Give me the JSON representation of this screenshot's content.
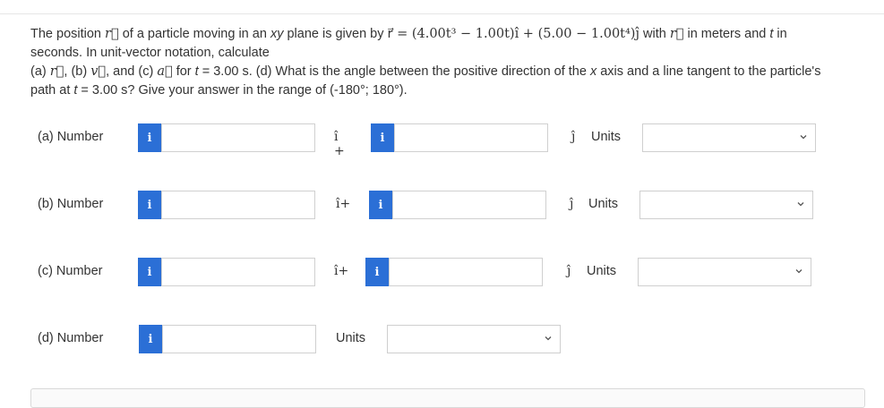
{
  "question": {
    "line1_a": "The position ",
    "r_sym": "r⃗",
    "line1_b": " of a particle moving in an ",
    "xy": "xy",
    "line1_c": " plane is given by ",
    "equation": "r⃗ = (4.00t³ − 1.00t)î + (5.00 − 1.00t⁴)ĵ",
    "line1_d": " with ",
    "line1_e": " in meters and ",
    "t": "t",
    "line1_f": " in",
    "line2": "seconds. In unit-vector notation, calculate",
    "line3_a": "(a) ",
    "line3_b": ", (b) ",
    "v_sym": "v⃗",
    "line3_c": ", and (c) ",
    "a_sym": "a⃗",
    "line3_d": " for ",
    "line3_e": " = 3.00 s. (d) What is the angle between the positive direction of the ",
    "x": "x",
    "line3_f": " axis and a line tangent to the particle's",
    "line4_a": "path at ",
    "line4_b": " = 3.00 s? Give your answer in the range of (-180°; 180°)."
  },
  "rows": [
    {
      "label": "(a)  Number",
      "i_btn": "i",
      "mid_unit": "î +",
      "j_unit": "ĵ",
      "units_label": "Units",
      "value1": "",
      "value2": "",
      "units_value": ""
    },
    {
      "label": "(b)  Number",
      "i_btn": "i",
      "mid_unit": "î+",
      "j_unit": "ĵ",
      "units_label": "Units",
      "value1": "",
      "value2": "",
      "units_value": ""
    },
    {
      "label": "(c)  Number",
      "i_btn": "i",
      "mid_unit": "î+",
      "j_unit": "ĵ",
      "units_label": "Units",
      "value1": "",
      "value2": "",
      "units_value": ""
    },
    {
      "label": "(d)  Number",
      "i_btn": "i",
      "units_label": "Units",
      "value1": "",
      "units_value": ""
    }
  ],
  "colors": {
    "info_button": "#2b6fd6",
    "text": "#333333",
    "border": "#d0d0d0"
  }
}
